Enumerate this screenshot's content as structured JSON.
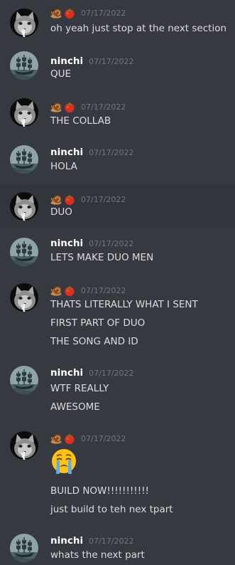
{
  "colors": {
    "background": "#36393f",
    "hover_background": "#32353b",
    "username": "#ffffff",
    "timestamp": "#72767d",
    "text": "#dcddde"
  },
  "users": {
    "user_a": {
      "display_icons": [
        "snail-emoji",
        "tomato-emoji"
      ],
      "avatar_icon": "gray-cat-avatar"
    },
    "user_b": {
      "name": "ninchi",
      "avatar_icon": "ghost-ship-avatar"
    }
  },
  "messages": [
    {
      "author": "user_a",
      "timestamp": "07/17/2022",
      "lines": [
        "oh yeah just stop at the next section"
      ]
    },
    {
      "author": "user_b",
      "name": "ninchi",
      "timestamp": "07/17/2022",
      "lines": [
        "QUE"
      ]
    },
    {
      "author": "user_a",
      "timestamp": "07/17/2022",
      "lines": [
        "THE COLLAB"
      ]
    },
    {
      "author": "user_b",
      "name": "ninchi",
      "timestamp": "07/17/2022",
      "lines": [
        "HOLA"
      ]
    },
    {
      "author": "user_a",
      "timestamp": "07/17/2022",
      "lines": [
        "DUO"
      ]
    },
    {
      "author": "user_b",
      "name": "ninchi",
      "timestamp": "07/17/2022",
      "lines": [
        "LETS MAKE DUO MEN"
      ]
    },
    {
      "author": "user_a",
      "timestamp": "07/17/2022",
      "lines": [
        "THATS LITERALLY WHAT I SENT",
        "FIRST PART OF DUO",
        "THE SONG AND ID"
      ]
    },
    {
      "author": "user_b",
      "name": "ninchi",
      "timestamp": "07/17/2022",
      "lines": [
        "WTF REALLY",
        "AWESOME"
      ]
    },
    {
      "author": "user_a",
      "timestamp": "07/17/2022",
      "big_emoji": "loudly-crying-face-emoji",
      "lines": [
        "BUILD NOW!!!!!!!!!!!",
        "just build to teh nex tpart"
      ]
    },
    {
      "author": "user_b",
      "name": "ninchi",
      "timestamp": "07/17/2022",
      "lines": [
        "whats the next part"
      ]
    }
  ]
}
